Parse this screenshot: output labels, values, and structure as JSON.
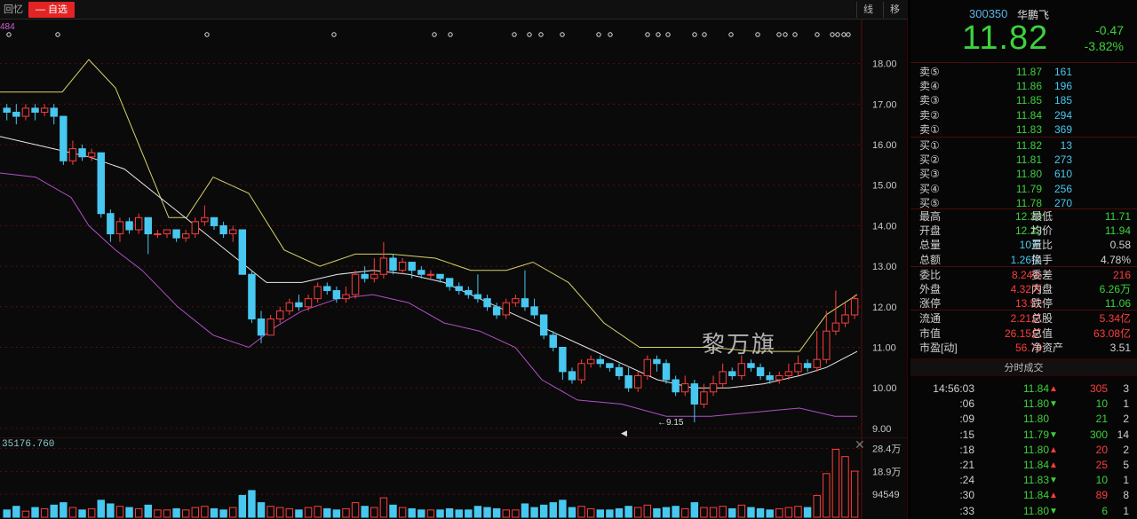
{
  "top_bar": {
    "recall_label": "回忆",
    "watchlist_label": "— 自选",
    "btn_line": "线",
    "btn_move": "移"
  },
  "price_axis": [
    "18.00",
    "17.00",
    "16.00",
    "15.00",
    "14.00",
    "13.00",
    "12.00",
    "11.00",
    "10.00",
    "9.00"
  ],
  "volume_axis": [
    "28.4万",
    "18.9万",
    "94549"
  ],
  "volume_header": "35176.760",
  "event_label_left": "484",
  "low_marker": "9.15",
  "watermark": "黎万旗",
  "colors": {
    "up": "#ff3c3c",
    "down": "#3cd23c",
    "cyan": "#48c8f0",
    "upper_band": "#d8d468",
    "mid_band": "#e8e8e8",
    "lower_band": "#b050c8"
  },
  "quote": {
    "code": "300350",
    "name": "华鹏飞",
    "last": "11.82",
    "change": "-0.47",
    "change_pct": "-3.82%"
  },
  "order_book": {
    "asks": [
      {
        "label": "卖⑤",
        "price": "11.87",
        "vol": "161"
      },
      {
        "label": "卖④",
        "price": "11.86",
        "vol": "196"
      },
      {
        "label": "卖③",
        "price": "11.85",
        "vol": "185"
      },
      {
        "label": "卖②",
        "price": "11.84",
        "vol": "294"
      },
      {
        "label": "卖①",
        "price": "11.83",
        "vol": "369"
      }
    ],
    "bids": [
      {
        "label": "买①",
        "price": "11.82",
        "vol": "13"
      },
      {
        "label": "买②",
        "price": "11.81",
        "vol": "273"
      },
      {
        "label": "买③",
        "price": "11.80",
        "vol": "610"
      },
      {
        "label": "买④",
        "price": "11.79",
        "vol": "256"
      },
      {
        "label": "买⑤",
        "price": "11.78",
        "vol": "270"
      }
    ]
  },
  "stats": [
    {
      "l1": "最高",
      "v1": "12.23",
      "c1": "#3cd23c",
      "l2": "最低",
      "v2": "11.71",
      "c2": "#3cd23c"
    },
    {
      "l1": "开盘",
      "v1": "12.23",
      "c1": "#3cd23c",
      "l2": "均价",
      "v2": "11.94",
      "c2": "#3cd23c"
    },
    {
      "l1": "总量",
      "v1": "10万",
      "c1": "#48c8f0",
      "l2": "量比",
      "v2": "0.58",
      "c2": "#d0d0d0"
    },
    {
      "l1": "总额",
      "v1": "1.26亿",
      "c1": "#48c8f0",
      "l2": "换手",
      "v2": "4.78%",
      "c2": "#d0d0d0"
    },
    {
      "l1": "委比",
      "v1": "8.24%",
      "c1": "#ff3c3c",
      "l2": "委差",
      "v2": "216",
      "c2": "#ff3c3c"
    },
    {
      "l1": "外盘",
      "v1": "4.32万",
      "c1": "#ff3c3c",
      "l2": "内盘",
      "v2": "6.26万",
      "c2": "#3cd23c"
    },
    {
      "l1": "涨停",
      "v1": "13.52",
      "c1": "#ff3c3c",
      "l2": "跌停",
      "v2": "11.06",
      "c2": "#3cd23c"
    },
    {
      "l1": "流通",
      "v1": "2.21亿",
      "c1": "#ff3c3c",
      "l2": "总股",
      "v2": "5.34亿",
      "c2": "#ff3c3c"
    },
    {
      "l1": "市值",
      "v1": "26.15亿",
      "c1": "#ff3c3c",
      "l2": "总值",
      "v2": "63.08亿",
      "c2": "#ff3c3c"
    },
    {
      "l1": "市盈[动]",
      "v1": "56.70",
      "c1": "#ff3c3c",
      "l2": "净资产",
      "v2": "3.51",
      "c2": "#d0d0d0"
    }
  ],
  "ticks_title": "分时成交",
  "ticks": [
    {
      "time": "14:56:03",
      "price": "11.84",
      "dir": "up",
      "vol": "305",
      "count": "3"
    },
    {
      "time": ":06",
      "price": "11.80",
      "dir": "down",
      "vol": "10",
      "count": "1"
    },
    {
      "time": ":09",
      "price": "11.80",
      "dir": "",
      "vol": "21",
      "count": "2"
    },
    {
      "time": ":15",
      "price": "11.79",
      "dir": "down",
      "vol": "300",
      "count": "14"
    },
    {
      "time": ":18",
      "price": "11.80",
      "dir": "up",
      "vol": "20",
      "count": "2"
    },
    {
      "time": ":21",
      "price": "11.84",
      "dir": "up",
      "vol": "25",
      "count": "5"
    },
    {
      "time": ":24",
      "price": "11.83",
      "dir": "down",
      "vol": "10",
      "count": "1"
    },
    {
      "time": ":30",
      "price": "11.84",
      "dir": "up",
      "vol": "89",
      "count": "8"
    },
    {
      "time": ":33",
      "price": "11.80",
      "dir": "down",
      "vol": "6",
      "count": "1"
    }
  ],
  "chart_data": {
    "type": "candlestick",
    "ylim": [
      8.8,
      19.0
    ],
    "candles": [
      [
        16.9,
        16.8,
        17.0,
        16.6
      ],
      [
        16.8,
        16.7,
        17.0,
        16.5
      ],
      [
        16.7,
        16.9,
        17.0,
        16.6
      ],
      [
        16.9,
        16.8,
        17.0,
        16.6
      ],
      [
        16.8,
        16.9,
        17.0,
        16.7
      ],
      [
        16.9,
        16.7,
        17.0,
        16.5
      ],
      [
        16.7,
        15.6,
        16.7,
        15.5
      ],
      [
        15.6,
        15.9,
        16.1,
        15.5
      ],
      [
        15.9,
        15.7,
        16.0,
        15.6
      ],
      [
        15.7,
        15.8,
        15.9,
        15.6
      ],
      [
        15.8,
        14.3,
        15.8,
        14.2
      ],
      [
        14.3,
        13.8,
        14.4,
        13.6
      ],
      [
        13.8,
        14.1,
        14.2,
        13.6
      ],
      [
        14.1,
        13.9,
        14.2,
        13.8
      ],
      [
        13.9,
        14.2,
        14.3,
        13.8
      ],
      [
        14.2,
        13.8,
        14.2,
        13.3
      ],
      [
        13.8,
        13.8,
        13.9,
        13.7
      ],
      [
        13.8,
        13.9,
        13.9,
        13.7
      ],
      [
        13.9,
        13.7,
        13.9,
        13.6
      ],
      [
        13.7,
        13.8,
        13.9,
        13.6
      ],
      [
        13.8,
        14.1,
        14.2,
        13.7
      ],
      [
        14.1,
        14.2,
        14.5,
        14.0
      ],
      [
        14.2,
        14.0,
        14.2,
        13.9
      ],
      [
        14.0,
        13.8,
        14.1,
        13.7
      ],
      [
        13.8,
        13.9,
        14.0,
        13.6
      ],
      [
        13.9,
        12.8,
        13.9,
        12.8
      ],
      [
        12.8,
        11.7,
        12.9,
        11.6
      ],
      [
        11.7,
        11.3,
        11.9,
        11.1
      ],
      [
        11.3,
        11.7,
        11.8,
        11.3
      ],
      [
        11.7,
        11.9,
        12.0,
        11.6
      ],
      [
        11.9,
        12.1,
        12.2,
        11.8
      ],
      [
        12.1,
        12.0,
        12.3,
        11.9
      ],
      [
        12.0,
        12.2,
        12.3,
        11.9
      ],
      [
        12.2,
        12.5,
        12.6,
        12.1
      ],
      [
        12.5,
        12.4,
        12.6,
        12.3
      ],
      [
        12.4,
        12.2,
        12.5,
        12.1
      ],
      [
        12.2,
        12.3,
        12.5,
        12.1
      ],
      [
        12.3,
        12.8,
        12.9,
        12.2
      ],
      [
        12.8,
        12.7,
        13.0,
        12.6
      ],
      [
        12.7,
        12.8,
        13.2,
        12.6
      ],
      [
        12.8,
        13.2,
        13.6,
        12.7
      ],
      [
        13.2,
        12.9,
        13.3,
        12.8
      ],
      [
        12.9,
        13.1,
        13.2,
        12.8
      ],
      [
        13.1,
        12.9,
        13.1,
        12.7
      ],
      [
        12.9,
        12.8,
        13.0,
        12.7
      ],
      [
        12.8,
        12.8,
        12.9,
        12.7
      ],
      [
        12.8,
        12.7,
        12.8,
        12.6
      ],
      [
        12.7,
        12.5,
        12.7,
        12.4
      ],
      [
        12.5,
        12.4,
        12.6,
        12.3
      ],
      [
        12.4,
        12.3,
        12.5,
        12.2
      ],
      [
        12.3,
        12.2,
        12.8,
        12.1
      ],
      [
        12.2,
        12.0,
        12.3,
        11.9
      ],
      [
        12.0,
        11.8,
        12.1,
        11.7
      ],
      [
        11.8,
        12.1,
        12.2,
        11.7
      ],
      [
        12.1,
        12.2,
        12.3,
        12.0
      ],
      [
        12.2,
        12.0,
        12.9,
        11.9
      ],
      [
        12.0,
        11.8,
        12.2,
        11.7
      ],
      [
        11.8,
        11.3,
        11.8,
        11.2
      ],
      [
        11.3,
        11.0,
        11.4,
        10.9
      ],
      [
        11.0,
        10.4,
        11.0,
        10.2
      ],
      [
        10.4,
        10.2,
        10.5,
        10.1
      ],
      [
        10.2,
        10.6,
        10.7,
        10.1
      ],
      [
        10.6,
        10.7,
        10.8,
        10.5
      ],
      [
        10.7,
        10.6,
        10.8,
        10.5
      ],
      [
        10.6,
        10.5,
        10.6,
        10.4
      ],
      [
        10.5,
        10.3,
        10.6,
        10.2
      ],
      [
        10.3,
        10.0,
        10.5,
        9.9
      ],
      [
        10.0,
        10.3,
        10.4,
        9.9
      ],
      [
        10.3,
        10.7,
        10.8,
        10.2
      ],
      [
        10.7,
        10.6,
        10.8,
        10.4
      ],
      [
        10.6,
        10.2,
        10.7,
        10.1
      ],
      [
        10.2,
        9.9,
        10.3,
        9.8
      ],
      [
        9.9,
        10.1,
        10.3,
        9.8
      ],
      [
        10.1,
        9.6,
        10.2,
        9.15
      ],
      [
        9.6,
        9.9,
        10.1,
        9.5
      ],
      [
        9.9,
        10.1,
        10.3,
        9.8
      ],
      [
        10.1,
        10.4,
        10.6,
        10.0
      ],
      [
        10.4,
        10.3,
        10.5,
        10.2
      ],
      [
        10.3,
        10.6,
        10.8,
        10.2
      ],
      [
        10.6,
        10.5,
        10.7,
        10.4
      ],
      [
        10.5,
        10.3,
        10.6,
        10.2
      ],
      [
        10.3,
        10.2,
        10.4,
        10.1
      ],
      [
        10.2,
        10.3,
        10.4,
        10.1
      ],
      [
        10.3,
        10.4,
        10.6,
        10.2
      ],
      [
        10.4,
        10.6,
        10.8,
        10.3
      ],
      [
        10.6,
        10.5,
        10.7,
        10.4
      ],
      [
        10.5,
        10.7,
        11.4,
        10.4
      ],
      [
        10.7,
        11.4,
        11.9,
        10.6
      ],
      [
        11.4,
        11.6,
        12.4,
        11.3
      ],
      [
        11.6,
        11.8,
        12.1,
        11.5
      ],
      [
        11.8,
        12.2,
        12.3,
        11.7
      ]
    ],
    "upper_band": [
      [
        0,
        17.3
      ],
      [
        70,
        17.3
      ],
      [
        100,
        18.1
      ],
      [
        130,
        17.4
      ],
      [
        160,
        15.8
      ],
      [
        190,
        14.2
      ],
      [
        210,
        14.2
      ],
      [
        240,
        15.2
      ],
      [
        280,
        14.8
      ],
      [
        320,
        13.4
      ],
      [
        360,
        13.0
      ],
      [
        400,
        13.3
      ],
      [
        440,
        13.3
      ],
      [
        490,
        13.2
      ],
      [
        530,
        12.9
      ],
      [
        570,
        12.9
      ],
      [
        600,
        13.1
      ],
      [
        640,
        12.6
      ],
      [
        680,
        11.6
      ],
      [
        720,
        11.0
      ],
      [
        760,
        11.0
      ],
      [
        800,
        11.0
      ],
      [
        850,
        10.9
      ],
      [
        900,
        10.9
      ],
      [
        930,
        11.8
      ],
      [
        965,
        12.3
      ]
    ],
    "mid_band": [
      [
        0,
        16.2
      ],
      [
        60,
        15.9
      ],
      [
        100,
        15.7
      ],
      [
        140,
        15.4
      ],
      [
        180,
        14.7
      ],
      [
        220,
        14.0
      ],
      [
        260,
        13.3
      ],
      [
        300,
        12.6
      ],
      [
        340,
        12.6
      ],
      [
        380,
        12.8
      ],
      [
        420,
        12.9
      ],
      [
        460,
        12.8
      ],
      [
        500,
        12.6
      ],
      [
        540,
        12.2
      ],
      [
        580,
        11.8
      ],
      [
        620,
        11.4
      ],
      [
        660,
        11.0
      ],
      [
        700,
        10.6
      ],
      [
        740,
        10.2
      ],
      [
        780,
        10.0
      ],
      [
        820,
        10.0
      ],
      [
        860,
        10.1
      ],
      [
        900,
        10.3
      ],
      [
        930,
        10.5
      ],
      [
        965,
        10.9
      ]
    ],
    "lower_band": [
      [
        0,
        15.3
      ],
      [
        40,
        15.2
      ],
      [
        80,
        14.7
      ],
      [
        100,
        14.0
      ],
      [
        130,
        13.4
      ],
      [
        160,
        12.9
      ],
      [
        200,
        12.0
      ],
      [
        240,
        11.3
      ],
      [
        280,
        11.0
      ],
      [
        310,
        11.5
      ],
      [
        340,
        11.9
      ],
      [
        380,
        12.2
      ],
      [
        420,
        12.3
      ],
      [
        460,
        12.1
      ],
      [
        500,
        11.6
      ],
      [
        540,
        11.4
      ],
      [
        580,
        11.0
      ],
      [
        610,
        10.2
      ],
      [
        650,
        9.7
      ],
      [
        700,
        9.6
      ],
      [
        750,
        9.3
      ],
      [
        800,
        9.3
      ],
      [
        850,
        9.4
      ],
      [
        900,
        9.5
      ],
      [
        940,
        9.3
      ],
      [
        965,
        9.3
      ]
    ],
    "volume_ylim": [
      0,
      300000
    ],
    "volumes": [
      30,
      45,
      25,
      40,
      35,
      50,
      60,
      40,
      30,
      35,
      70,
      55,
      45,
      40,
      35,
      50,
      30,
      30,
      35,
      30,
      40,
      45,
      35,
      30,
      40,
      90,
      110,
      60,
      45,
      40,
      35,
      30,
      40,
      45,
      35,
      30,
      35,
      60,
      45,
      40,
      80,
      50,
      40,
      35,
      30,
      30,
      30,
      35,
      30,
      30,
      45,
      40,
      35,
      30,
      30,
      55,
      40,
      50,
      60,
      70,
      40,
      45,
      35,
      30,
      30,
      35,
      45,
      40,
      50,
      35,
      40,
      45,
      35,
      60,
      40,
      40,
      45,
      35,
      50,
      40,
      35,
      30,
      35,
      40,
      45,
      40,
      90,
      180,
      280,
      250,
      190
    ],
    "event_markers": [
      10,
      65,
      233,
      376,
      489,
      507,
      579,
      596,
      609,
      633,
      674,
      687,
      729,
      741,
      752,
      782,
      793,
      823,
      853,
      877,
      884,
      895,
      920,
      937,
      943,
      950,
      955
    ]
  }
}
